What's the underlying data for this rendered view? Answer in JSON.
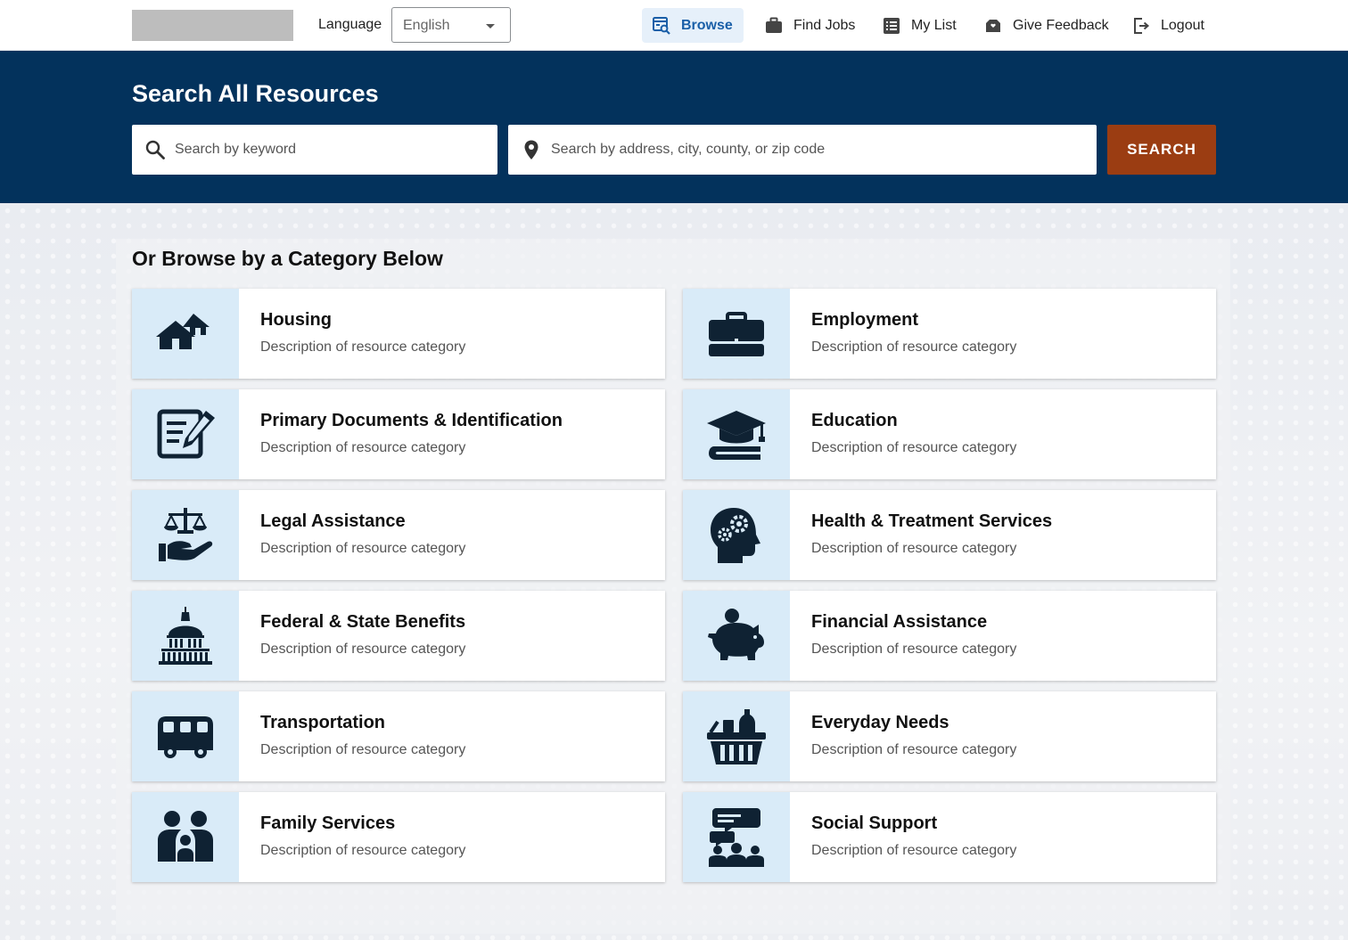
{
  "header": {
    "language_label": "Language",
    "language_selected": "English",
    "nav": [
      {
        "label": "Browse",
        "icon": "browse-icon",
        "active": true
      },
      {
        "label": "Find Jobs",
        "icon": "briefcase-icon"
      },
      {
        "label": "My List",
        "icon": "list-icon"
      },
      {
        "label": "Give Feedback",
        "icon": "feedback-icon"
      },
      {
        "label": "Logout",
        "icon": "logout-icon"
      }
    ]
  },
  "hero": {
    "title": "Search All Resources",
    "keyword_placeholder": "Search by keyword",
    "location_placeholder": "Search by address, city, county, or zip code",
    "search_button": "SEARCH"
  },
  "browse": {
    "title": "Or Browse by a Category Below",
    "categories": [
      {
        "title": "Housing",
        "desc": "Description of resource category",
        "icon": "houses-icon"
      },
      {
        "title": "Employment",
        "desc": "Description of resource category",
        "icon": "briefcase-icon"
      },
      {
        "title": "Primary Documents & Identification",
        "desc": "Description of resource category",
        "icon": "document-pen-icon"
      },
      {
        "title": "Education",
        "desc": "Description of resource category",
        "icon": "graduation-cap-icon"
      },
      {
        "title": "Legal Assistance",
        "desc": "Description of resource category",
        "icon": "scales-hand-icon"
      },
      {
        "title": "Health & Treatment Services",
        "desc": "Description of resource category",
        "icon": "head-gears-icon"
      },
      {
        "title": "Federal & State Benefits",
        "desc": "Description of resource category",
        "icon": "capitol-icon"
      },
      {
        "title": "Financial Assistance",
        "desc": "Description of resource category",
        "icon": "piggy-bank-icon"
      },
      {
        "title": "Transportation",
        "desc": "Description of resource category",
        "icon": "bus-icon"
      },
      {
        "title": "Everyday Needs",
        "desc": "Description of resource category",
        "icon": "grocery-basket-icon"
      },
      {
        "title": "Family Services",
        "desc": "Description of resource category",
        "icon": "family-icon"
      },
      {
        "title": "Social Support",
        "desc": "Description of resource category",
        "icon": "group-chat-icon"
      }
    ]
  },
  "colors": {
    "hero_bg": "#03325c",
    "search_button": "#9b3d12",
    "icon_tile": "#d9ebf8",
    "icon_fill": "#0f2233",
    "nav_active": "#1a5fa8"
  }
}
